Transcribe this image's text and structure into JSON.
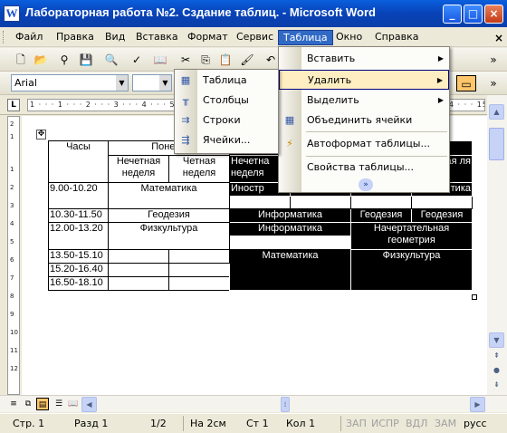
{
  "window": {
    "title": "Лабораторная работа №2. Сздание таблиц. - Microsoft Word",
    "icon_letter": "W",
    "minimize": "_",
    "maximize": "□",
    "close": "×"
  },
  "menubar": {
    "items": [
      "Файл",
      "Правка",
      "Вид",
      "Вставка",
      "Формат",
      "Сервис",
      "Таблица",
      "Окно",
      "Справка"
    ],
    "active": "Таблица",
    "close_doc": "×"
  },
  "formatting": {
    "style": "Arial",
    "font_size": ""
  },
  "ruler": {
    "corner_icon": "L",
    "marks": "1 · · · 1 · · · 2 · · · 3 · · · 4 · · · 5 · · · 6 · · · 7 · · · 8 · · · 9 · · · 10 · · · 11 · · · 12 · · · 13 · · · 14 · · · 15 · · · 16 · · · 17 · · · 18 · · · 19",
    "vertical_marks": [
      "2",
      "1",
      "1",
      "2",
      "3",
      "4",
      "5",
      "6",
      "7",
      "8",
      "9",
      "10",
      "11",
      "12"
    ]
  },
  "table_menu": {
    "items": [
      {
        "label": "Вставить",
        "icon": "insert-icon",
        "submenu": true
      },
      {
        "label": "Удалить",
        "icon": "delete-icon",
        "submenu": true
      },
      {
        "label": "Выделить",
        "icon": "select-icon",
        "submenu": true
      },
      {
        "label": "Объединить ячейки",
        "icon": "merge-cells-icon",
        "submenu": false
      },
      {
        "label": "Автоформат таблицы...",
        "icon": "autoformat-icon",
        "submenu": false
      },
      {
        "label": "Свойства таблицы...",
        "icon": "table-properties-icon",
        "submenu": false
      }
    ],
    "highlighted": "Удалить",
    "more": "»"
  },
  "delete_submenu": {
    "items": [
      "Таблица",
      "Столбцы",
      "Строки",
      "Ячейки..."
    ]
  },
  "document_table": {
    "header_col": "Часы",
    "day": "Понеде",
    "odd_week": "Нечетная неделя",
    "even_week": "Четная неделя",
    "odd_week_dark": "Нечетна неделя",
    "even_week_right": "ая ля",
    "times": [
      "9.00-10.20",
      "10.30-11.50",
      "12.00-13.20",
      "13.50-15.10",
      "15.20-16.40",
      "16.50-18.10"
    ],
    "r1_monday": "Математика",
    "r1_dark": "Иностр",
    "r1_right": "тика",
    "r2_monday": "Геодезия",
    "r2_inf": "Информатика",
    "r2_geo1": "Геодезия",
    "r2_geo2": "Геодезия",
    "r3_monday": "Физкультура",
    "r3_inf": "Информатика",
    "r3_geom": "Начертательная геометрия",
    "r4_math": "Математика",
    "r4_pe": "Физкультура"
  },
  "statusbar": {
    "page": "Стр. 1",
    "section": "Разд 1",
    "pages": "1/2",
    "position": "На 2см",
    "line": "Ст 1",
    "column": "Кол 1",
    "rec": "ЗАП",
    "trk": "ИСПР",
    "ext": "ВДЛ",
    "ovr": "ЗАМ",
    "language": "русс"
  }
}
